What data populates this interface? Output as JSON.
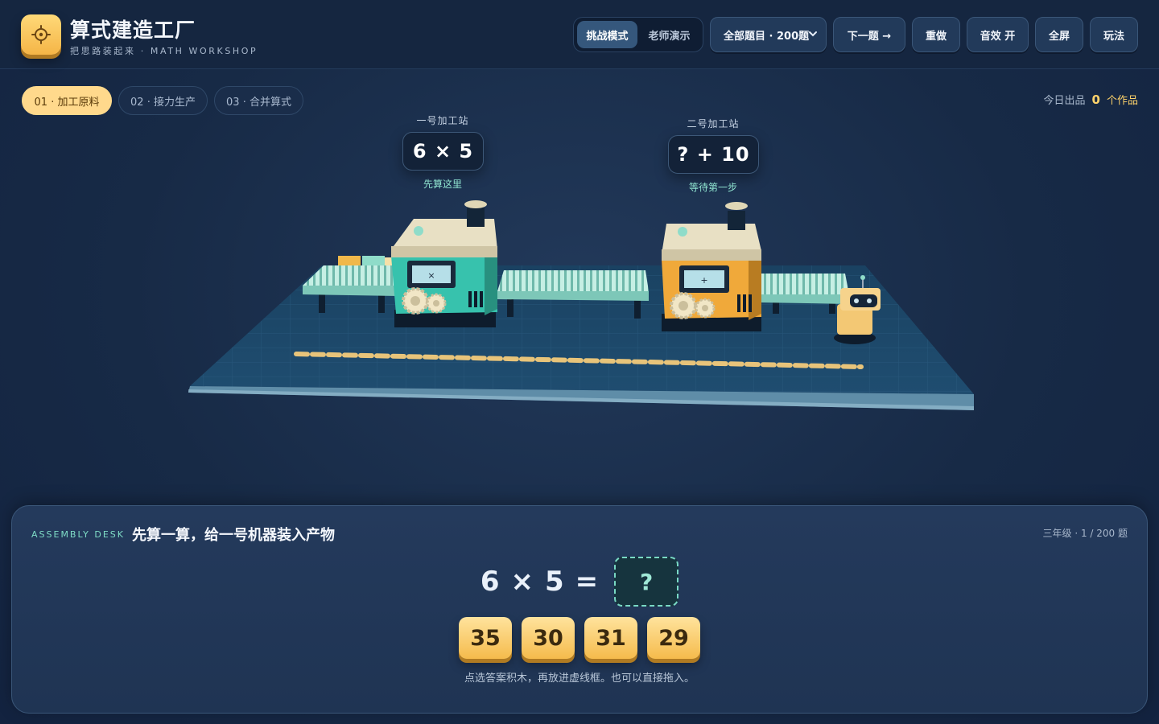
{
  "header": {
    "title": "算式建造工厂",
    "subtitle": "把思路装起来 · MATH WORKSHOP",
    "mode": {
      "challenge_label": "挑战模式",
      "teacher_label": "老师演示",
      "active": "challenge"
    },
    "question_select": {
      "value": "全部题目 · 200题"
    },
    "next_label": "下一题 →",
    "redo_label": "重做",
    "sound_label": "音效 开",
    "fullscreen_label": "全屏",
    "howto_label": "玩法"
  },
  "steps": [
    {
      "label": "01 · 加工原料",
      "active": true
    },
    {
      "label": "02 · 接力生产",
      "active": false
    },
    {
      "label": "03 · 合并算式",
      "active": false
    }
  ],
  "output": {
    "label": "今日出品",
    "count": "0",
    "unit": "个作品"
  },
  "stations": [
    {
      "label": "一号加工站",
      "expression": "6 × 5",
      "hint": "先算这里",
      "screen_symbol": "×",
      "body_color": "#37c2ad"
    },
    {
      "label": "二号加工站",
      "expression": "? + 10",
      "hint": "等待第一步",
      "screen_symbol": "+",
      "body_color": "#f0a93a"
    }
  ],
  "desk": {
    "tag": "ASSEMBLY DESK",
    "title": "先算一算，给一号机器装入产物",
    "progress": "三年级 · 1 / 200 题",
    "equation": {
      "a": "6",
      "op": "×",
      "b": "5",
      "eq": "=",
      "slot": "?"
    },
    "options": [
      "35",
      "30",
      "31",
      "29"
    ],
    "instruction": "点选答案积木，再放进虚线框。也可以直接拖入。"
  },
  "colors": {
    "accent_gold": "#f5bb4c",
    "accent_teal": "#7fdcc6",
    "active_mode": "#35577c"
  }
}
